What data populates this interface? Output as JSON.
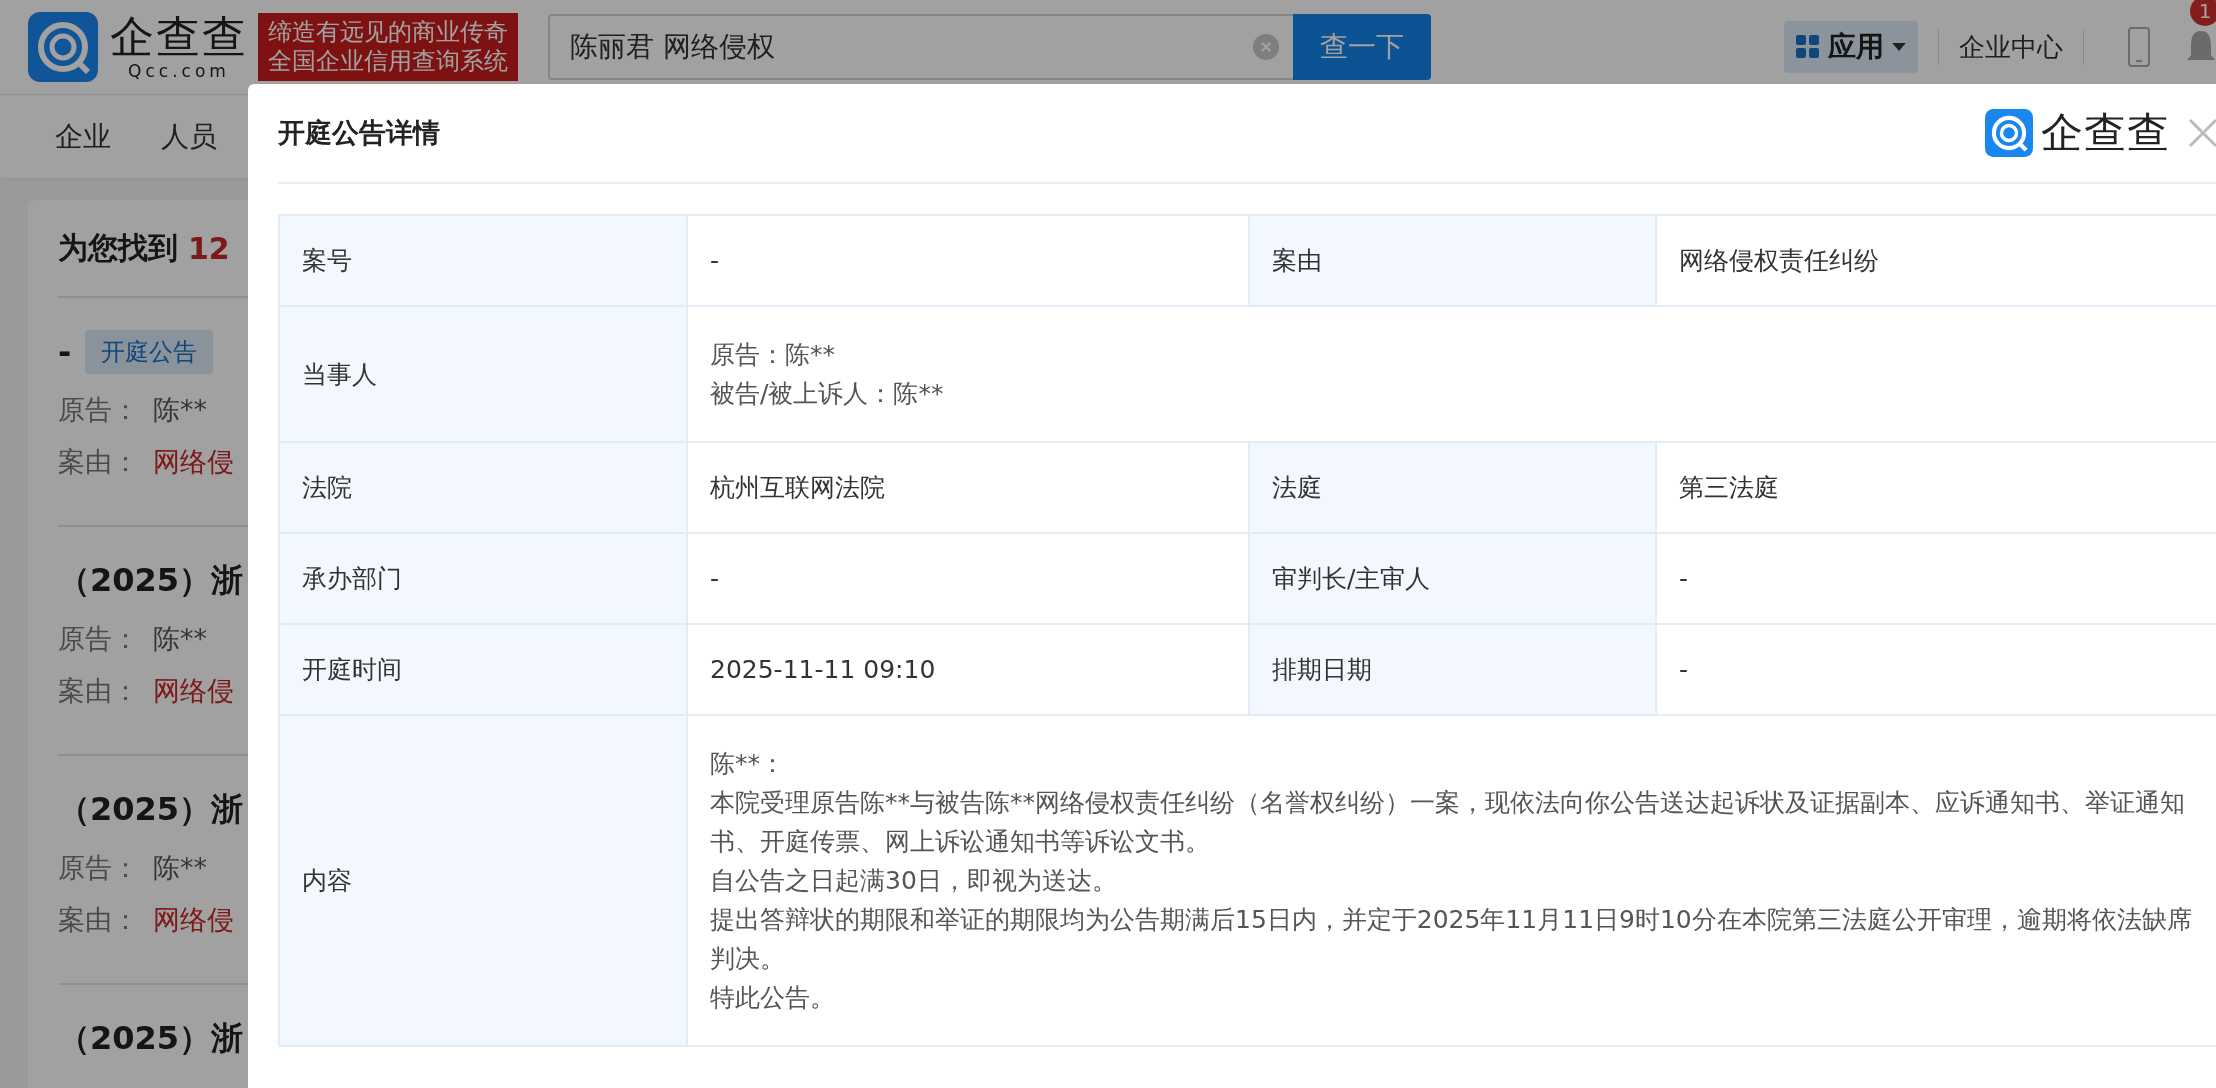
{
  "header": {
    "logo": {
      "brand": "企查查",
      "domain": "Qcc.com"
    },
    "slogan": [
      "缔造有远见的商业传奇",
      "全国企业信用查询系统"
    ],
    "search": {
      "value": "陈丽君 网络侵权",
      "button": "查一下"
    },
    "apps_button": "应用",
    "enterprise_center": "企业中心",
    "notification_badge": "1"
  },
  "nav": [
    "企业",
    "人员"
  ],
  "results": {
    "summary_prefix": "为您找到",
    "count": "12",
    "items": [
      {
        "title": "-",
        "tag": "开庭公告",
        "plaintiff_label": "原告：",
        "plaintiff": "陈**",
        "cause_label": "案由：",
        "cause": "网络侵"
      },
      {
        "title": "（2025）浙",
        "plaintiff_label": "原告：",
        "plaintiff": "陈**",
        "cause_label": "案由：",
        "cause": "网络侵"
      },
      {
        "title": "（2025）浙",
        "plaintiff_label": "原告：",
        "plaintiff": "陈**",
        "cause_label": "案由：",
        "cause": "网络侵"
      },
      {
        "title": "（2025）浙"
      }
    ]
  },
  "modal": {
    "title": "开庭公告详情",
    "logo_text": "企查查",
    "rows": [
      {
        "kind": "pair",
        "cells": [
          "案号",
          "-",
          "案由",
          "网络侵权责任纠纷"
        ]
      },
      {
        "kind": "lines",
        "label": "当事人",
        "lines": [
          "原告：陈**",
          "被告/被上诉人：陈**"
        ]
      },
      {
        "kind": "pair",
        "cells": [
          "法院",
          "杭州互联网法院",
          "法庭",
          "第三法庭"
        ]
      },
      {
        "kind": "pair",
        "cells": [
          "承办部门",
          "-",
          "审判长/主审人",
          "-"
        ]
      },
      {
        "kind": "pair",
        "cells": [
          "开庭时间",
          "2025-11-11 09:10",
          "排期日期",
          "-"
        ]
      },
      {
        "kind": "lines",
        "label": "内容",
        "lines": [
          "陈**：",
          "本院受理原告陈**与被告陈**网络侵权责任纠纷（名誉权纠纷）一案，现依法向你公告送达起诉状及证据副本、应诉通知书、举证通知书、开庭传票、网上诉讼通知书等诉讼文书。",
          "自公告之日起满30日，即视为送达。",
          "提出答辩状的期限和举证的期限均为公告期满后15日内，并定于2025年11月11日9时10分在本院第三法庭公开审理，逾期将依法缺席判决。",
          "特此公告。"
        ]
      }
    ]
  }
}
